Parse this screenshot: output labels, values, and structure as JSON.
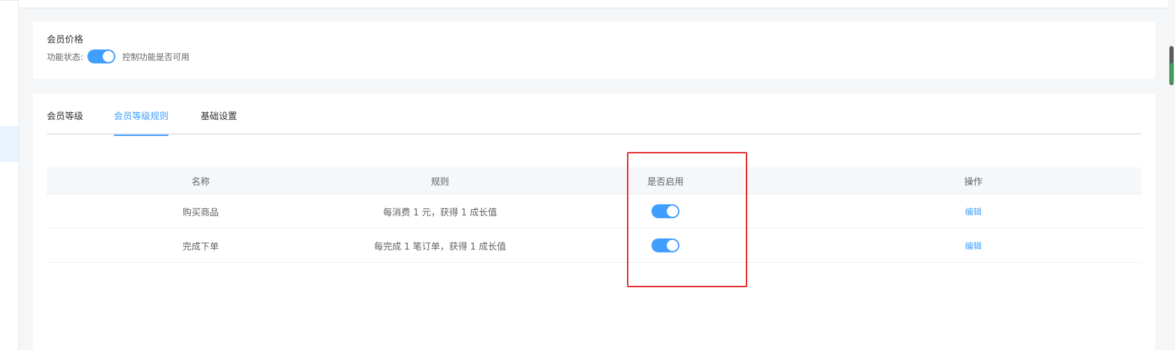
{
  "price_card": {
    "title": "会员价格",
    "status_label": "功能状态:",
    "status_enabled": true,
    "status_hint": "控制功能是否可用"
  },
  "tabs": [
    {
      "label": "会员等级",
      "active": false
    },
    {
      "label": "会员等级规则",
      "active": true
    },
    {
      "label": "基础设置",
      "active": false
    }
  ],
  "table": {
    "headers": [
      "名称",
      "规则",
      "是否启用",
      "操作"
    ],
    "rows": [
      {
        "name": "购买商品",
        "rule": "每消费 1 元，获得 1 成长值",
        "enabled": true,
        "action": "编辑"
      },
      {
        "name": "完成下单",
        "rule": "每完成 1 笔订单，获得 1 成长值",
        "enabled": true,
        "action": "编辑"
      }
    ]
  },
  "colors": {
    "accent": "#409eff",
    "highlight": "#e62828"
  }
}
